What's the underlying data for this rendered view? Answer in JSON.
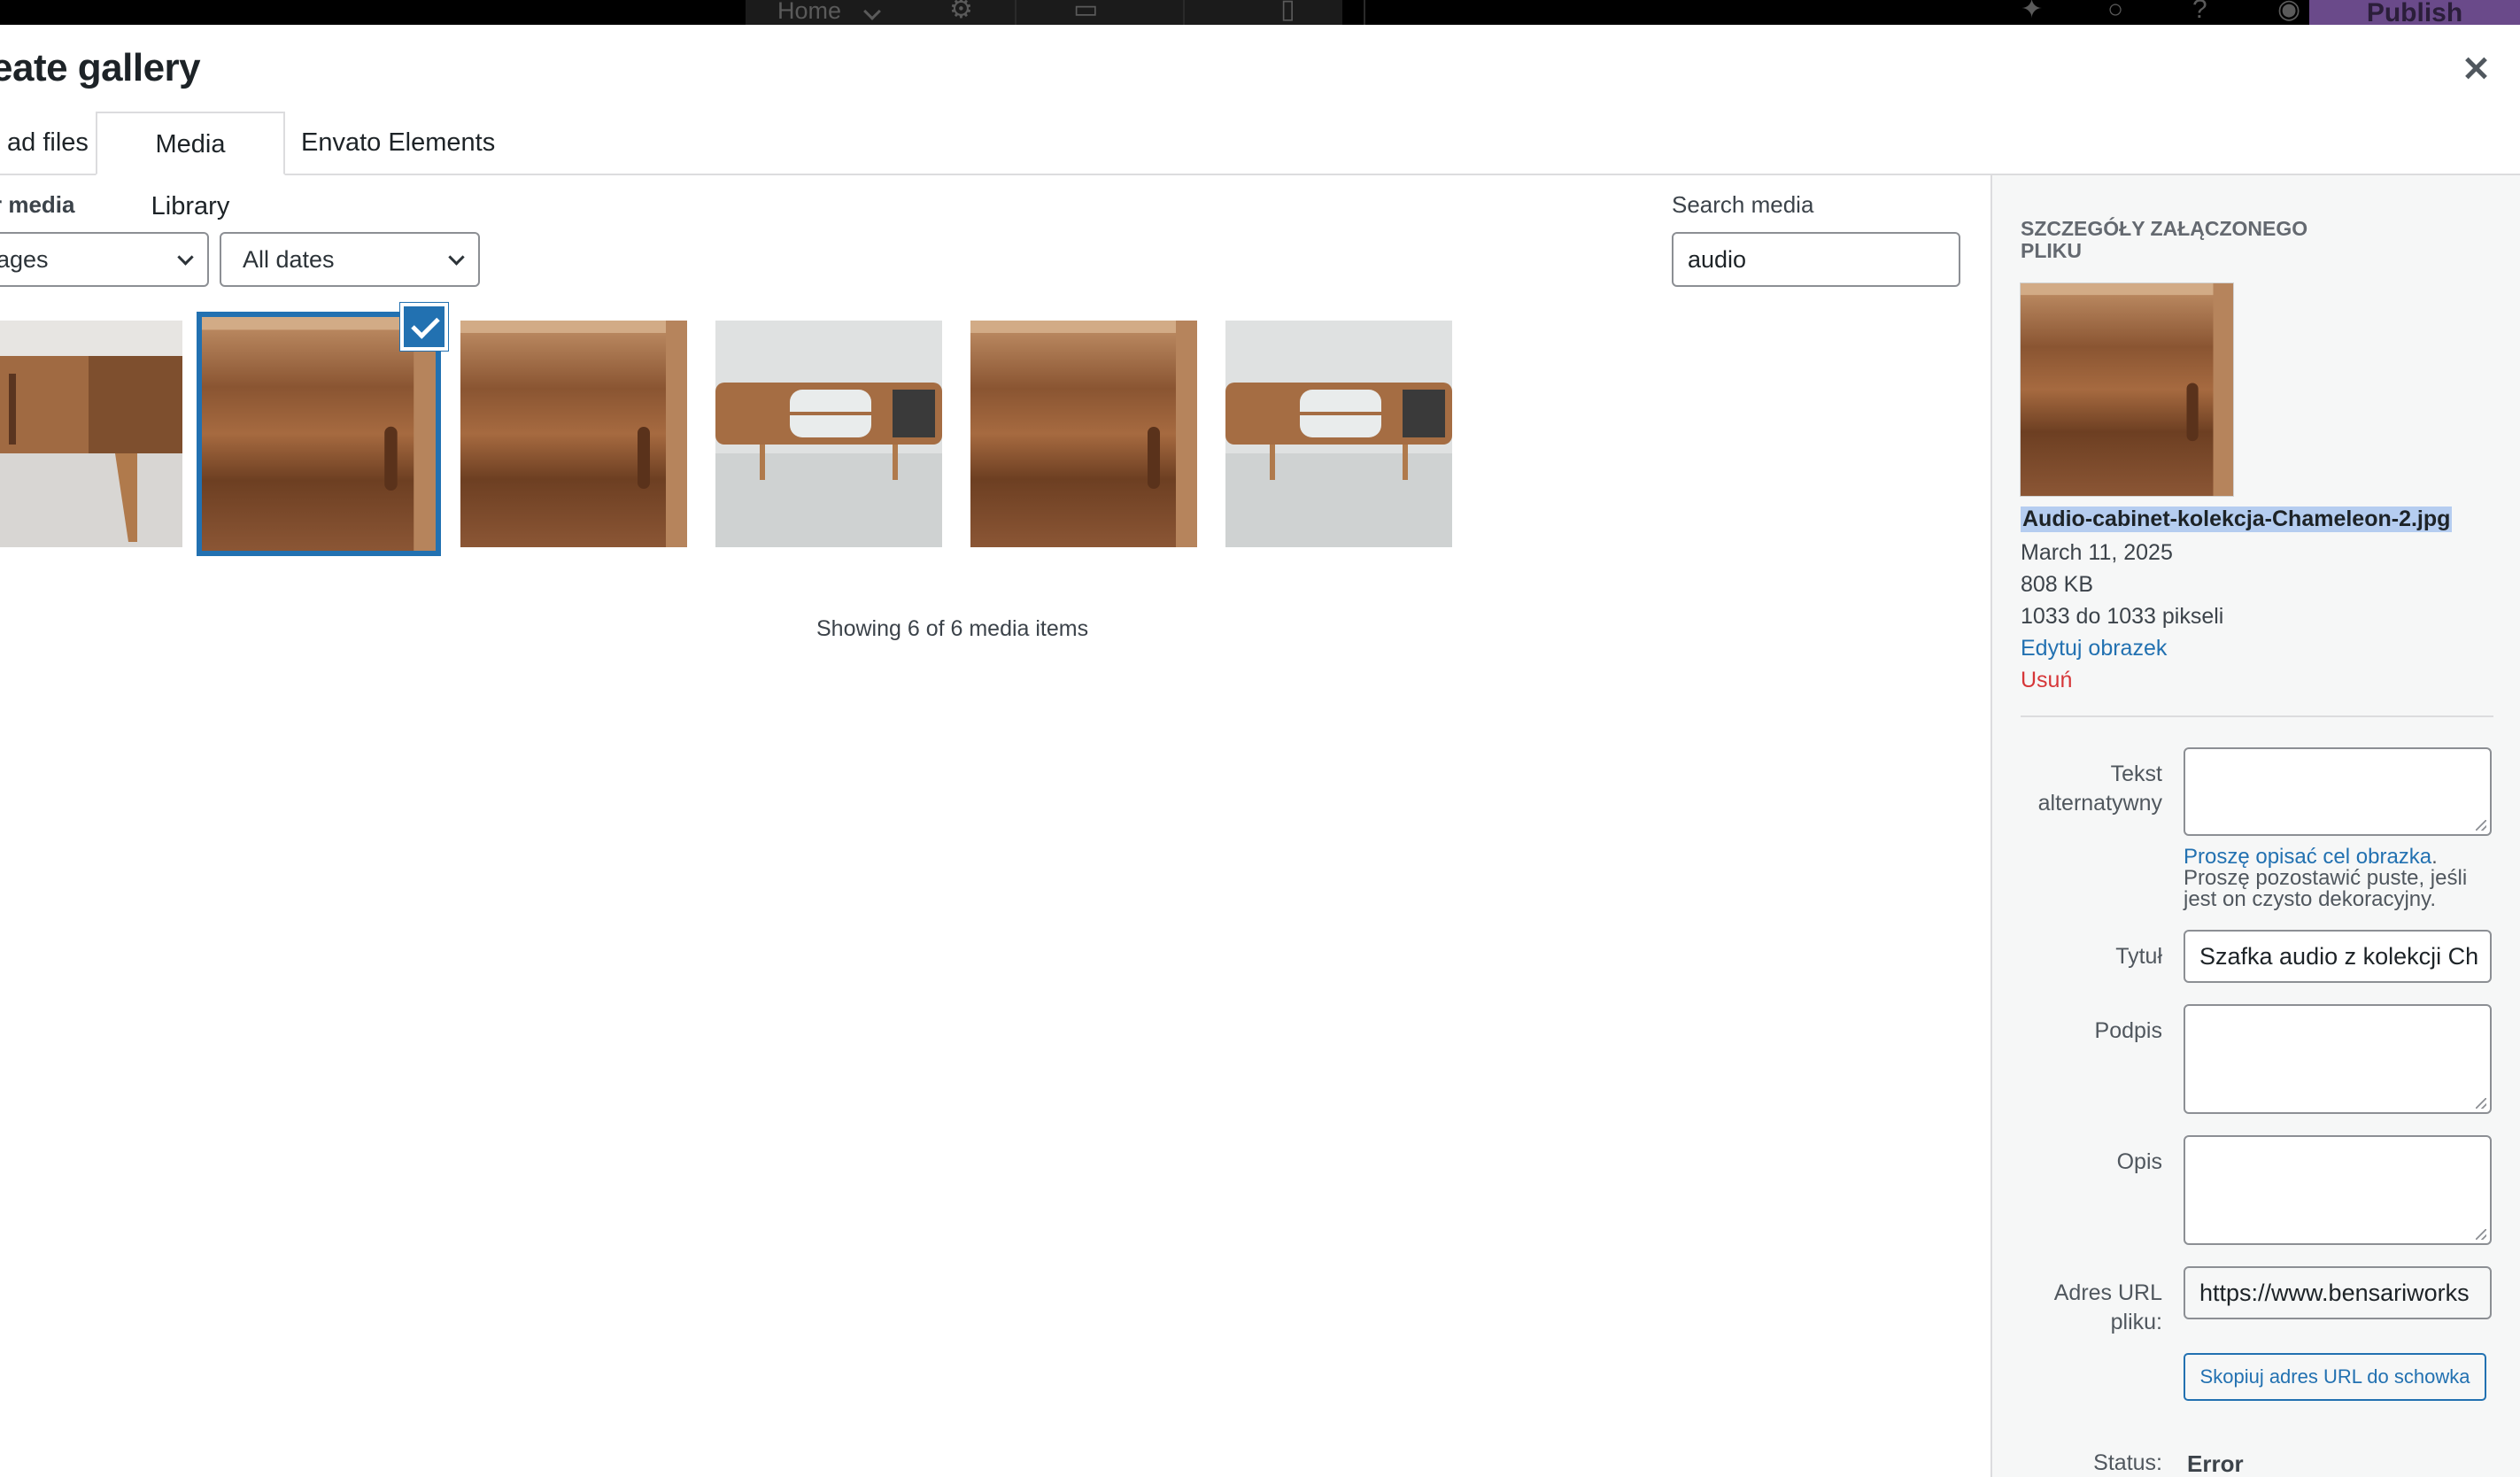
{
  "topbar": {
    "home_label": "Home",
    "publish_label": "Publish"
  },
  "modal": {
    "title": "eate gallery",
    "close_icon": "close-icon"
  },
  "tabs": [
    {
      "label": "ad files"
    },
    {
      "label": "Media Library"
    },
    {
      "label": "Envato Elements"
    }
  ],
  "filters": {
    "label": "r media",
    "type_selected": "ages",
    "date_selected": "All dates"
  },
  "search": {
    "label": "Search media",
    "value": "audio"
  },
  "status_line": "Showing 6 of 6 media items",
  "sidebar": {
    "heading": "SZCZEGÓŁY ZAŁĄCZONEGO PLIKU",
    "filename": "Audio-cabinet-kolekcja-Chameleon-2.jpg",
    "date": "March 11, 2025",
    "size": "808 KB",
    "dimensions": "1033 do 1033 pikseli",
    "edit_link": "Edytuj obrazek",
    "delete_link": "Usuń",
    "fields": {
      "alt_label": "Tekst alternatywny",
      "alt_help_link": "Proszę opisać cel obrazka",
      "alt_help_rest": ". Proszę pozostawić puste, jeśli jest on czysto dekoracyjny.",
      "title_label": "Tytuł",
      "title_value": "Szafka audio z kolekcji Ch",
      "caption_label": "Podpis",
      "description_label": "Opis",
      "url_label": "Adres URL pliku:",
      "url_value": "https://www.bensariworks",
      "copy_button": "Skopiuj adres URL do schowka",
      "status_label": "Status:",
      "status_value": "Error"
    }
  },
  "colors": {
    "accent": "#2271b1",
    "delete": "#d63638",
    "publish_bg": "#6a4a8a"
  }
}
